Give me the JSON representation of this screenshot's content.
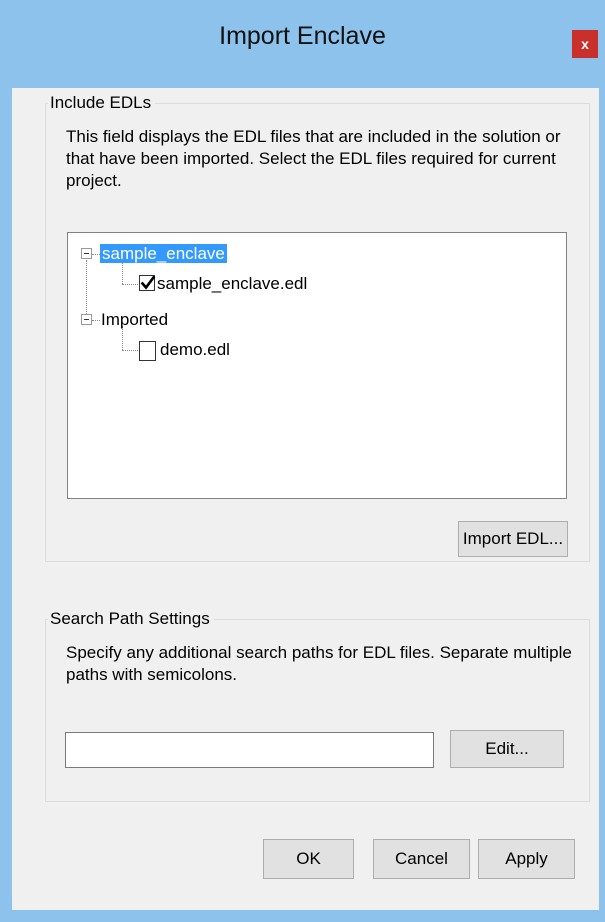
{
  "window": {
    "title": "Import Enclave",
    "close_label": "x"
  },
  "include_edls": {
    "legend": "Include EDLs",
    "description_lines": [
      "This field displays the EDL files that are included in the solution or",
      "that have been imported. Select the EDL files required for current",
      "project."
    ],
    "tree": {
      "nodes": [
        {
          "label": "sample_enclave",
          "expanded": true,
          "selected": true,
          "children": [
            {
              "label": "sample_enclave.edl",
              "checked": true
            }
          ]
        },
        {
          "label": "Imported",
          "expanded": true,
          "selected": false,
          "children": [
            {
              "label": "demo.edl",
              "checked": false
            }
          ]
        }
      ]
    },
    "import_button": "Import EDL..."
  },
  "search_path": {
    "legend": "Search Path Settings",
    "description_lines": [
      "Specify any additional search paths for EDL files. Separate multiple",
      "paths with semicolons."
    ],
    "path_value": "",
    "edit_button": "Edit..."
  },
  "footer": {
    "ok_label": "OK",
    "cancel_label": "Cancel",
    "apply_label": "Apply"
  },
  "colors": {
    "frame": "#8cc2ec",
    "selection": "#3399ff",
    "close": "#c9302c"
  }
}
